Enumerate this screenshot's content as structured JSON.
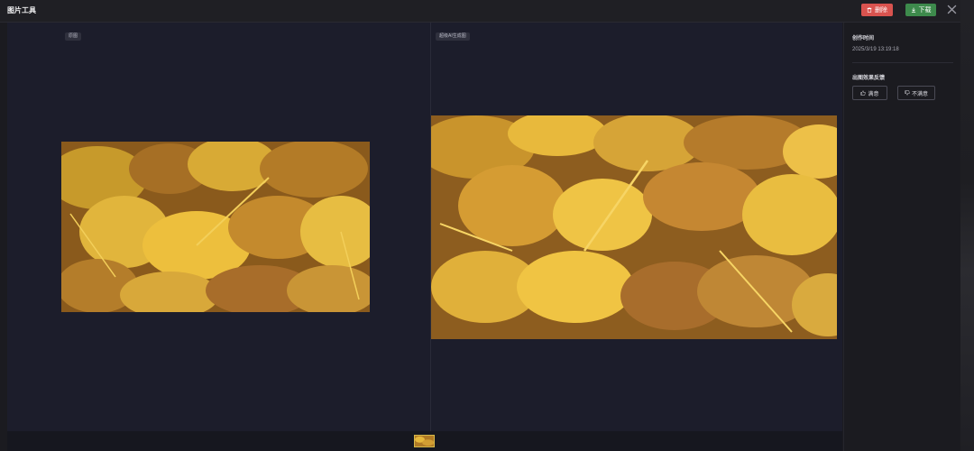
{
  "header": {
    "title": "图片工具",
    "delete_label": "删除",
    "download_label": "下载"
  },
  "viewer": {
    "original_tag": "原图",
    "ai_tag": "超级AI生成图"
  },
  "panel": {
    "created_label": "创作时间",
    "created_value": "2025/3/19 13:19:18",
    "feedback_label": "出图效果反馈",
    "satisfied_label": "满意",
    "unsatisfied_label": "不满意"
  },
  "colors": {
    "accent_delete": "#d9534f",
    "accent_download": "#3d8a4c",
    "thumb_border": "#d6b94a"
  }
}
